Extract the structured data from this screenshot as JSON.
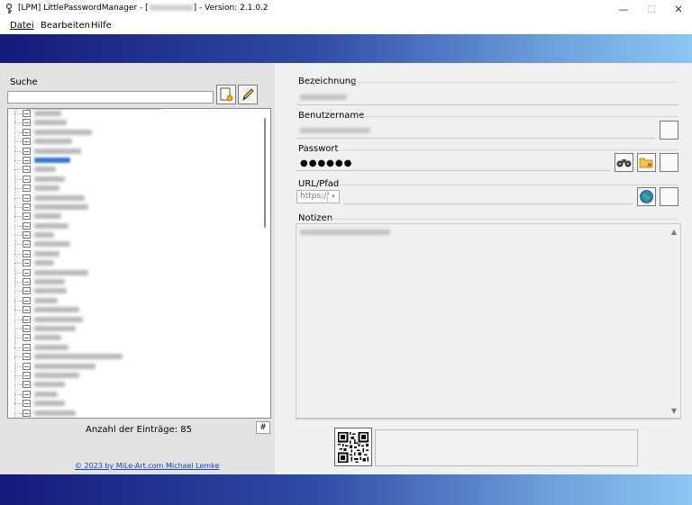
{
  "window": {
    "title_prefix": "[LPM] LittlePasswordManager - [",
    "title_suffix": "] - Version: 2.1.0.2",
    "min_symbol": "—",
    "max_symbol": "☐",
    "close_symbol": "✕"
  },
  "menu": {
    "items": [
      {
        "label": "Datei"
      },
      {
        "label": "Bearbeiten"
      },
      {
        "label": "Hilfe"
      }
    ]
  },
  "left": {
    "search_label": "Suche",
    "search_value": "",
    "entry_count_label": "Anzahl der Einträge: 85",
    "hash_button_label": "#",
    "copyright": "© 2023 by MiLe-Art.com  Michael Lemke"
  },
  "right": {
    "fields": {
      "bezeichnung_label": "Bezeichnung",
      "benutzername_label": "Benutzername",
      "passwort_label": "Passwort",
      "passwort_value": "●●●●●●",
      "url_label": "URL/Pfad",
      "url_scheme": "https://",
      "notizen_label": "Notizen"
    }
  },
  "icons": {
    "app": "key-person-icon",
    "add_entry": "new-document-icon",
    "edit_entry": "pencil-icon",
    "reveal_password": "binoculars-icon",
    "generate_password": "folder-key-icon",
    "open_url": "globe-icon",
    "qr": "qr-code-icon"
  },
  "colors": {
    "banner_start": "#151a78",
    "banner_end": "#8cc6f2",
    "selection": "#3a78d4",
    "link": "#1a3cc8"
  }
}
